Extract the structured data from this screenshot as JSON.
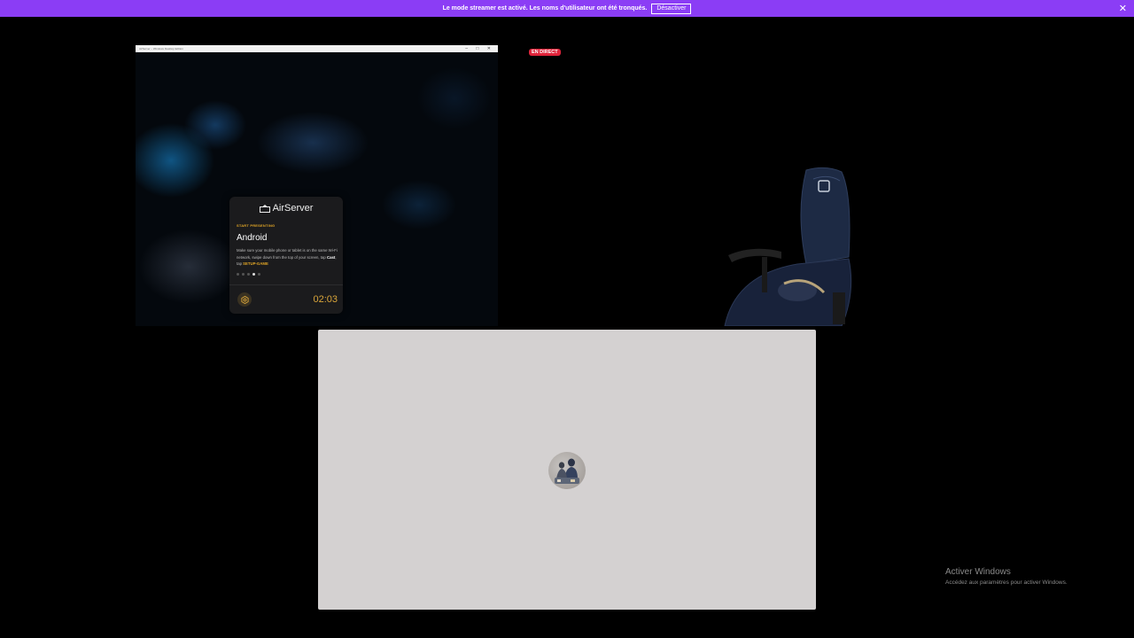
{
  "banner": {
    "message": "Le mode streamer est activé. Les noms d'utilisateur ont été tronqués.",
    "button_label": "Désactiver",
    "close_glyph": "✕",
    "color": "#8b3df5"
  },
  "share": {
    "window_title": "AirServer – Windows Desktop Edition",
    "airserver": {
      "logo_text": "AirServer",
      "section_label": "START PRESENTING",
      "heading": "Android",
      "desc_before": "Make sure your mobile phone or tablet is on the same Wi-Fi network, swipe down from the top of your screen, tap ",
      "desc_bold": "Cast",
      "desc_middle": ", tap ",
      "desc_highlight": "SETUP-GAME",
      "dots_total": 5,
      "dots_active_index": 3,
      "timer": "02:03",
      "accent_color": "#e0a526"
    }
  },
  "live_badge": {
    "label": "EN DIRECT",
    "color": "#e0243b"
  },
  "participant": {
    "tile_color": "#d4d1d1",
    "avatar_icon": "user-avatar"
  },
  "watermark": {
    "title": "Activer Windows",
    "subtitle": "Accédez aux paramètres pour activer Windows."
  }
}
